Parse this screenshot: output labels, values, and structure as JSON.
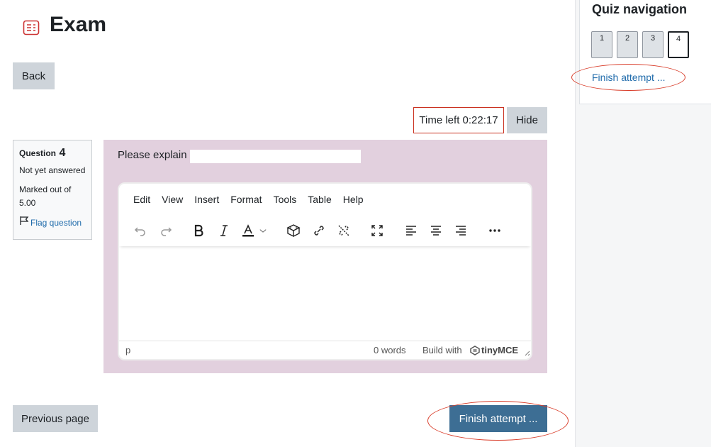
{
  "page": {
    "title": "Exam",
    "back_label": "Back"
  },
  "timer": {
    "text": "Time left 0:22:17",
    "hide_label": "Hide"
  },
  "question_info": {
    "label": "Question",
    "number": "4",
    "status": "Not yet answered",
    "marked_label": "Marked out of",
    "marked_value": "5.00",
    "flag_label": "Flag question"
  },
  "question": {
    "prompt": "Please explain :"
  },
  "editor": {
    "menu": [
      "Edit",
      "View",
      "Insert",
      "Format",
      "Tools",
      "Table",
      "Help"
    ],
    "status_path": "p",
    "word_count": "0 words",
    "build_with": "Build with",
    "brand": "tinyMCE"
  },
  "quiz_nav": {
    "title": "Quiz navigation",
    "buttons": [
      "1",
      "2",
      "3",
      "4"
    ],
    "current": "4",
    "finish_link": "Finish attempt ..."
  },
  "footer": {
    "prev_label": "Previous page",
    "finish_label": "Finish attempt ..."
  },
  "colors": {
    "accent": "#3d6e94",
    "link": "#1f6bab",
    "highlight": "#d93d2a",
    "question_bg": "#e2d0de"
  }
}
